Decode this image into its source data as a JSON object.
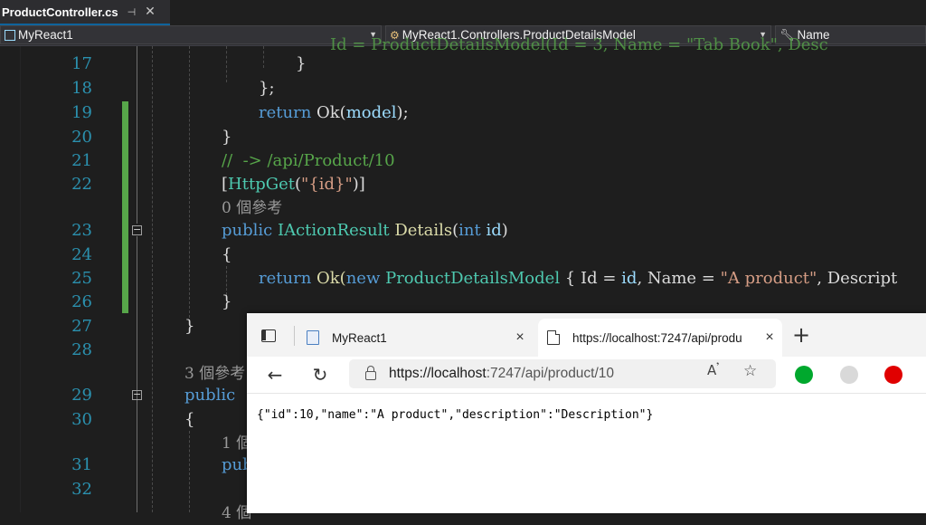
{
  "vs": {
    "tab": {
      "title": "ProductController.cs",
      "pin_icon": "pin-icon",
      "close_icon": "close-icon"
    },
    "nav": {
      "project": "MyReact1",
      "type": "MyReact1.Controllers.ProductDetailsModel",
      "member": "Name"
    },
    "code_lines": {
      "l17": {
        "num": "17"
      },
      "l18": {
        "num": "18"
      },
      "l19": {
        "num": "19",
        "t1": "return",
        "t2": " Ok(",
        "t3": "model",
        "t4": ");"
      },
      "l20": {
        "num": "20"
      },
      "l21": {
        "num": "21",
        "comment": "//  -> /api/Product/10"
      },
      "l22": {
        "num": "22",
        "a1": "[",
        "a2": "HttpGet",
        "a3": "(",
        "a4": "\"{id}\"",
        "a5": ")]"
      },
      "refs0": {
        "text": "0 個參考"
      },
      "l23": {
        "num": "23",
        "t1": "public",
        "t2": " IActionResult ",
        "t3": "Details",
        "t4": "(",
        "t5": "int",
        "t6": " id",
        "t7": ")"
      },
      "l24": {
        "num": "24"
      },
      "l25": {
        "num": "25",
        "t1": "return",
        "t2": " Ok(",
        "t3": "new",
        "t4": " ",
        "t5": "ProductDetailsModel",
        "t6": " {",
        "t7": " Id = ",
        "t8": "id",
        "t9": ", Name = ",
        "t10": "\"A product\"",
        "t11": ", Descript"
      },
      "l26": {
        "num": "26"
      },
      "l27": {
        "num": "27"
      },
      "l28": {
        "num": "28"
      },
      "refs3": {
        "text": "3 個參考"
      },
      "l29": {
        "num": "29",
        "t1": "public"
      },
      "l30": {
        "num": "30"
      },
      "refs1": {
        "text": "1 個"
      },
      "l31": {
        "num": "31",
        "t1": "pub"
      },
      "l32": {
        "num": "32"
      },
      "refs4": {
        "text": "4 個"
      }
    }
  },
  "browser": {
    "tabs": [
      {
        "title": "MyReact1",
        "close": "×"
      },
      {
        "title": "https://localhost:7247/api/produ",
        "close": "×"
      }
    ],
    "new_tab": "+",
    "address": {
      "host": "https://localhost",
      "rest": ":7247/api/product/10"
    },
    "content": "{\"id\":10,\"name\":\"A product\",\"description\":\"Description\"}"
  }
}
